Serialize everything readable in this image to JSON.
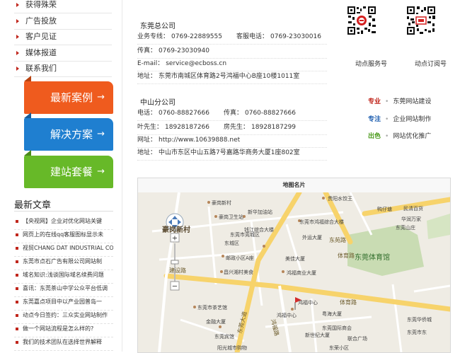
{
  "nav": {
    "items": [
      {
        "label": "获得殊荣"
      },
      {
        "label": "广告投放"
      },
      {
        "label": "客户见证"
      },
      {
        "label": "媒体报道"
      },
      {
        "label": "联系我们"
      }
    ],
    "buttons": [
      {
        "label": "最新案例",
        "color": "#ef5b1e"
      },
      {
        "label": "解决方案",
        "color": "#1f7fd0"
      },
      {
        "label": "建站套餐",
        "color": "#67b928"
      }
    ],
    "arrow": "→"
  },
  "latest": {
    "title": "最新文章",
    "articles": [
      "【央视网】企业对优化网站关键",
      "网页上的在线qq客服图标显示未",
      "视贸CHANG DAT INDUSTRIAL CO.",
      "东莞市点石广告有限公司网站制",
      "域名知识:浅谈国际域名续费问题",
      "喜讯：东莞茶山中学公众平台低调",
      "东莞嘉点项目中以产业园普岛一",
      "动点今日签约：三众实业网站制作",
      "做一个网站流程是怎么样的?",
      "我们的技术团队在选择世界解释"
    ]
  },
  "contacts": {
    "dongguan": {
      "name": "东莞总公司",
      "hotline_label": "业务专线：",
      "hotline": "0769-22889555",
      "service_label": "客服电话：",
      "service": "0769-23030016",
      "fax_label": "传真：",
      "fax": "0769-23030940",
      "email_label": "E-mail：",
      "email": "service@ecboss.cn",
      "address_label": "地址：",
      "address": "东莞市南城区体育路2号鸿福中心B座10楼1011室"
    },
    "zhongshan": {
      "name": "中山分公司",
      "phone_label": "电话：",
      "phone": "0760-88827666",
      "fax_label": "传真：",
      "fax": "0760-88827666",
      "ye_label": "叶先生：",
      "ye": "18928187266",
      "fang_label": "房先生：",
      "fang": "18928187299",
      "web_label": "网址：",
      "web": "http://www.10639888.net",
      "address_label": "地址：",
      "address": "中山市东区中山五路7号嘉路华商务大厦1座802室"
    }
  },
  "qr": {
    "service_caption": "动点服务号",
    "subscribe_caption": "动点订阅号"
  },
  "services": [
    {
      "tag": "专业",
      "color": "#c0261c",
      "text": "东莞网站建设"
    },
    {
      "tag": "专注",
      "color": "#1f5fb0",
      "text": "企业网站制作"
    },
    {
      "tag": "出色",
      "color": "#4a9a1a",
      "text": "网站优化推广"
    }
  ],
  "map": {
    "title": "地图名片",
    "labels": {
      "district": "豪岗新村",
      "place1": "豪岗新村",
      "place2": "新华加油站",
      "place3": "豪岗卫生站",
      "place4": "东莞市莞城区",
      "place5": "钱江综合大楼",
      "place6": "外运大厦",
      "place7": "东城区",
      "place8": "东莞体育馆",
      "place9": "鸿福中心",
      "place10": "东莞市茶艺馆",
      "place11": "金融大厦",
      "place12": "东莞宾馆",
      "place13": "联合广场",
      "place14": "民清百货",
      "place15": "东莞山庄",
      "place16": "贵阳水饺王",
      "place17": "东莞市鸿福综合大楼",
      "place18": "鸭仔塘",
      "place19": "华润万家",
      "place20": "东苑路",
      "place21": "体育路",
      "place22": "建设路",
      "place23": "东莞大道",
      "place24": "美佳大厦",
      "place25": "邮政小区A座",
      "place26": "昌兴湘村美食",
      "place27": "鸿福路",
      "place28": "阳光城市购物",
      "place29": "东荣小区",
      "place30": "鸿福商业大厦",
      "place31": "粤海大厦",
      "place32": "东莞国际商会",
      "place33": "东莞华侨城",
      "place34": "东莞市东",
      "place35": "新世纪大厦",
      "place36": "鸿福中心"
    }
  }
}
